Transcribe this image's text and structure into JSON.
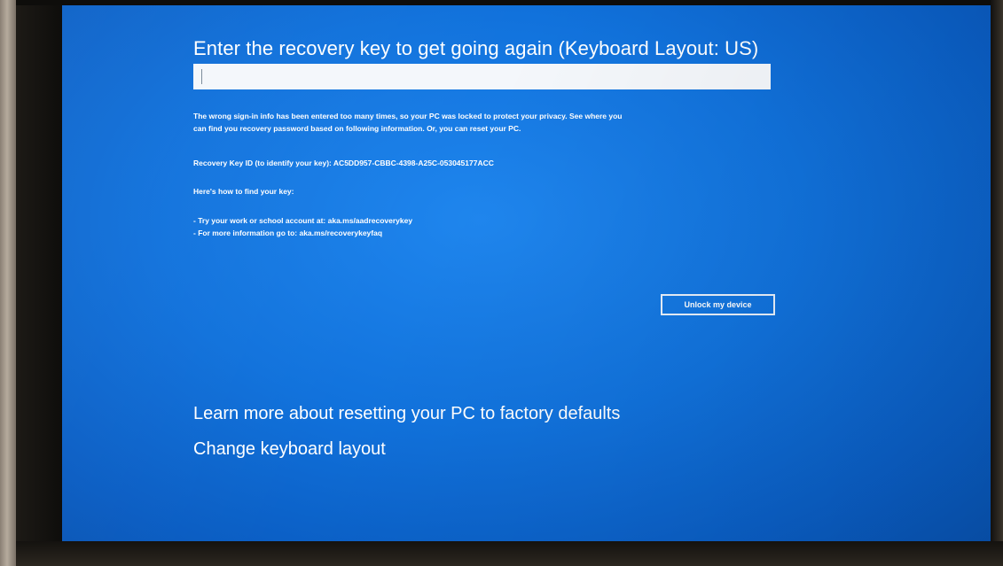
{
  "recovery": {
    "title": "Enter the recovery key to get going again (Keyboard Layout: US)",
    "key_input_value": "",
    "message_line_1": "The wrong sign-in info has been entered too many times, so your PC was locked to protect your privacy. See where you",
    "message_line_2": "can find you recovery password based on following information. Or, you can reset your PC.",
    "recovery_key_id": "Recovery Key ID (to identify your key): AC5DD957-CBBC-4398-A25C-053045177ACC",
    "how_to_heading": "Here's how to find your key:",
    "tip_1": "- Try your work or school account at: aka.ms/aadrecoverykey",
    "tip_2": "- For more information go to: aka.ms/recoverykeyfaq",
    "unlock_label": "Unlock my device"
  },
  "links": {
    "reset_label": "Learn more about resetting your PC to factory defaults",
    "keyboard_label": "Change keyboard layout"
  },
  "colors": {
    "screen_blue": "#1172dc",
    "text": "#ffffff",
    "input_bg": "#f4f7fb"
  }
}
